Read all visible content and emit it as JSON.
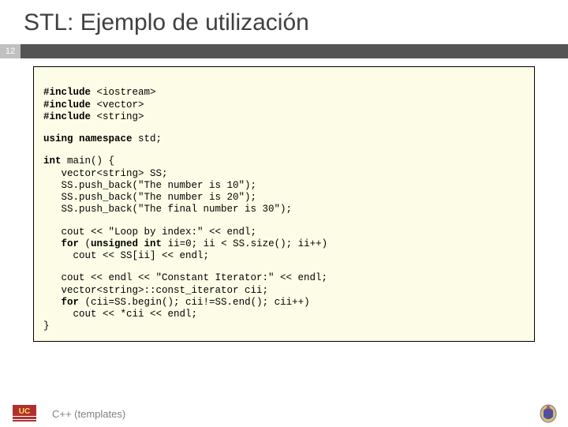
{
  "title": "STL: Ejemplo de utilización",
  "page_number": "12",
  "footer": "C++ (templates)",
  "code": {
    "b1_l1_a": "#include ",
    "b1_l1_b": "<iostream>",
    "b1_l2_a": "#include ",
    "b1_l2_b": "<vector>",
    "b1_l3_a": "#include ",
    "b1_l3_b": "<string>",
    "b2_l1_a": "using namespace ",
    "b2_l1_b": "std;",
    "b3_l1_a": "int ",
    "b3_l1_b": "main() {",
    "b3_l2": "   vector<string> SS;",
    "b3_l3": "   SS.push_back(\"The number is 10\");",
    "b3_l4": "   SS.push_back(\"The number is 20\");",
    "b3_l5": "   SS.push_back(\"The final number is 30\");",
    "b4_l1": "   cout << \"Loop by index:\" << endl;",
    "b4_l2_a": "   ",
    "b4_l2_b": "for ",
    "b4_l2_c": "(",
    "b4_l2_d": "unsigned int ",
    "b4_l2_e": "ii=0; ii < SS.size(); ii++)",
    "b4_l3": "     cout << SS[ii] << endl;",
    "b5_l1": "   cout << endl << \"Constant Iterator:\" << endl;",
    "b5_l2": "   vector<string>::const_iterator cii;",
    "b5_l3_a": "   ",
    "b5_l3_b": "for ",
    "b5_l3_c": "(cii=SS.begin(); cii!=SS.end(); cii++)",
    "b5_l4": "     cout << *cii << endl;",
    "b5_l5": "}"
  }
}
